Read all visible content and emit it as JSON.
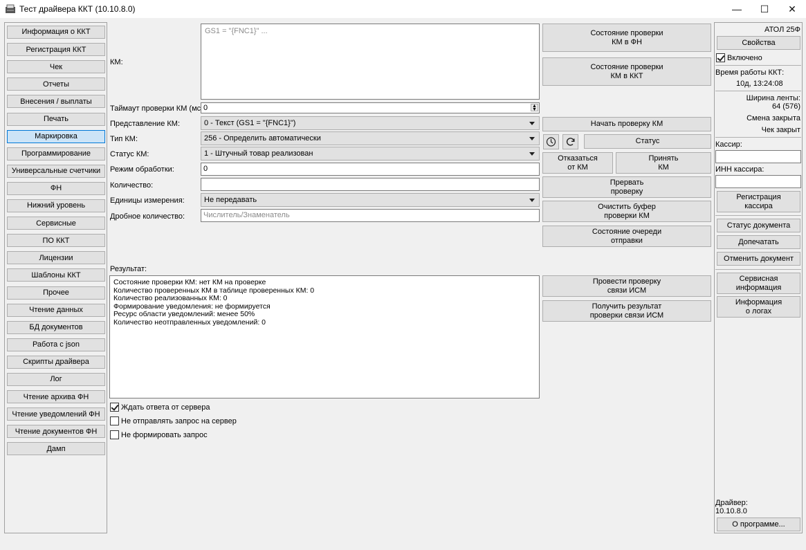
{
  "window": {
    "title": "Тест драйвера ККТ (10.10.8.0)",
    "controls": [
      "—",
      "☐",
      "✕"
    ]
  },
  "sidebar": {
    "items": [
      {
        "label": "Информация о ККТ"
      },
      {
        "label": "Регистрация ККТ"
      },
      {
        "label": "Чек"
      },
      {
        "label": "Отчеты"
      },
      {
        "label": "Внесения / выплаты"
      },
      {
        "label": "Печать"
      },
      {
        "label": "Маркировка",
        "selected": true
      },
      {
        "label": "Программирование"
      },
      {
        "label": "Универсальные счетчики"
      },
      {
        "label": "ФН"
      },
      {
        "label": "Нижний уровень"
      },
      {
        "label": "Сервисные"
      },
      {
        "label": "ПО ККТ"
      },
      {
        "label": "Лицензии"
      },
      {
        "label": "Шаблоны ККТ"
      },
      {
        "label": "Прочее"
      },
      {
        "label": "Чтение данных"
      },
      {
        "label": "БД документов"
      },
      {
        "label": "Работа с json"
      },
      {
        "label": "Скрипты драйвера"
      },
      {
        "label": "Лог"
      },
      {
        "label": "Чтение архива ФН"
      },
      {
        "label": "Чтение уведомлений ФН"
      },
      {
        "label": "Чтение документов ФН"
      },
      {
        "label": "Дамп"
      }
    ]
  },
  "form": {
    "km_label": "КМ:",
    "km_placeholder": "GS1 = \"{FNC1}\" ...",
    "timeout_label": "Таймаут проверки КМ (мс):",
    "timeout_value": "0",
    "representation_label": "Представление КМ:",
    "representation_value": "0 - Текст (GS1 = \"{FNC1}\")",
    "type_label": "Тип КМ:",
    "type_value": "256 - Определить автоматически",
    "status_label": "Статус КМ:",
    "status_value": "1 - Штучный товар реализован",
    "mode_label": "Режим обработки:",
    "mode_value": "0",
    "quantity_label": "Количество:",
    "quantity_value": "",
    "units_label": "Единицы измерения:",
    "units_value": "Не передавать",
    "fraction_label": "Дробное количество:",
    "fraction_placeholder": "Числитель/Знаменатель",
    "result_label": "Результат:",
    "result_lines": [
      "Состояние проверки КМ: нет КМ на проверке",
      "Количество проверенных КМ в таблице проверенных КМ: 0",
      "Количество реализованных КМ: 0",
      "Формирование уведомления: не формируется",
      "Ресурс области уведомлений: менее 50%",
      "Количество неотправленных уведомлений: 0"
    ],
    "checkboxes": [
      {
        "label": "Ждать ответа от сервера",
        "checked": true
      },
      {
        "label": "Не отправлять запрос на сервер",
        "checked": false
      },
      {
        "label": "Не формировать запрос",
        "checked": false
      }
    ]
  },
  "actions": {
    "state_fn": "Состояние проверки\nКМ в ФН",
    "state_kkt": "Состояние проверки\nКМ в ККТ",
    "start_check": "Начать проверку КМ",
    "status": "Статус",
    "reject": "Отказаться\nот КМ",
    "accept": "Принять\nКМ",
    "interrupt": "Прервать\nпроверку",
    "clear_buffer": "Очистить буфер\nпроверки КМ",
    "queue_state": "Состояние очереди\nотправки",
    "check_ism": "Провести проверку\nсвязи ИСМ",
    "ism_result": "Получить результат\nпроверки связи ИСМ"
  },
  "right": {
    "model": "АТОЛ 25Ф",
    "properties": "Свойства",
    "enabled_label": "Включено",
    "enabled": true,
    "uptime_label": "Время работы ККТ:",
    "uptime_value": "10д, 13:24:08",
    "tape_label": "Ширина ленты:",
    "tape_value": "64 (576)",
    "shift_status": "Смена закрыта",
    "receipt_status": "Чек закрыт",
    "cashier_label": "Кассир:",
    "cashier_value": "",
    "inn_label": "ИНН кассира:",
    "inn_value": "",
    "register_cashier": "Регистрация\nкассира",
    "doc_status": "Статус документа",
    "reprint": "Допечатать",
    "cancel_doc": "Отменить документ",
    "service_info": "Сервисная\nинформация",
    "log_info": "Информация\nо логах",
    "driver_label": "Драйвер:",
    "driver_version": "10.10.8.0",
    "about": "О программе..."
  }
}
